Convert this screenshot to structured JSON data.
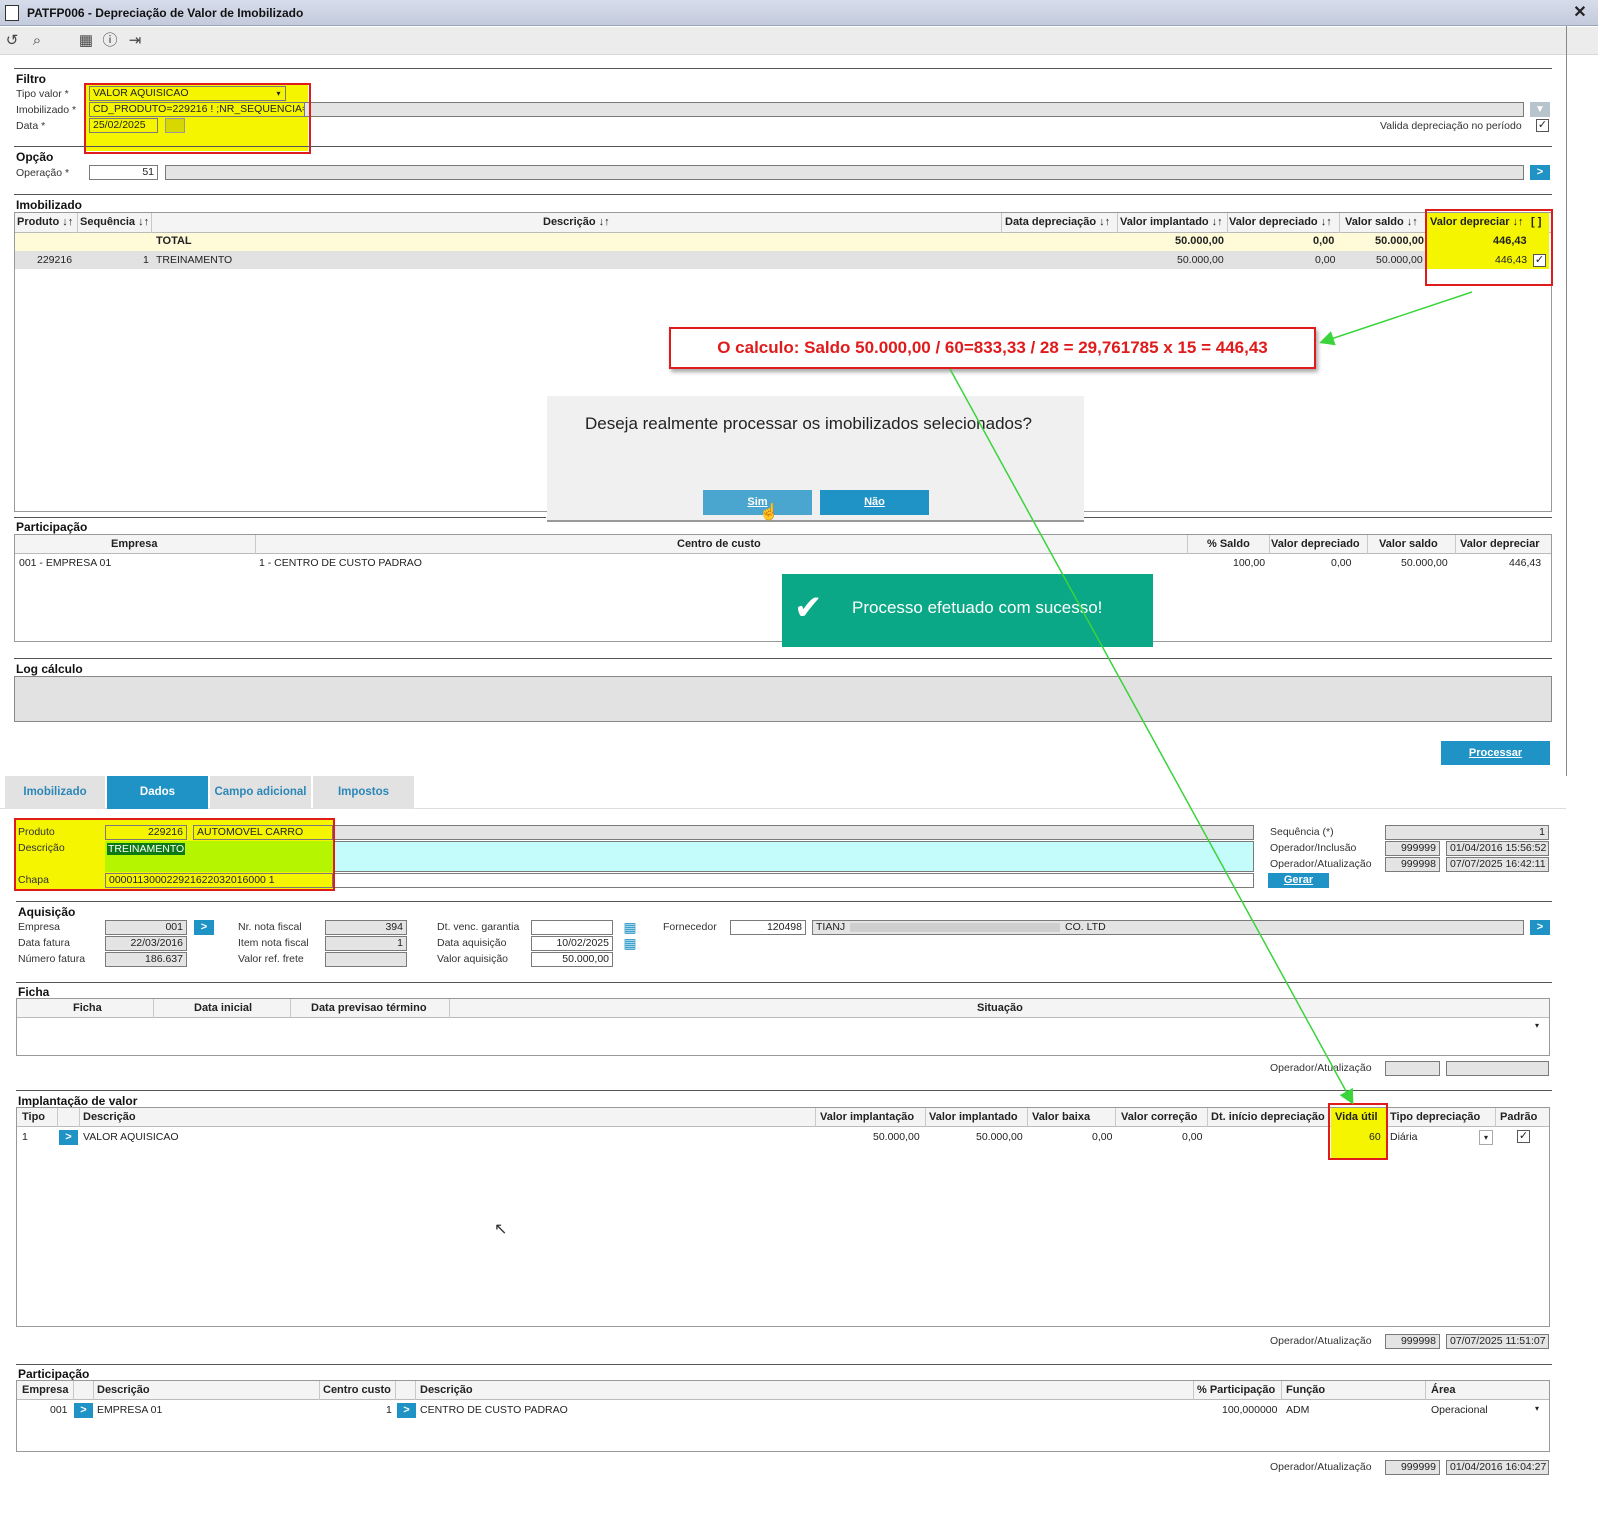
{
  "window": {
    "title": "PATFP006 - Depreciação de Valor de Imobilizado",
    "close": "✕"
  },
  "filtro": {
    "title": "Filtro",
    "tipo_valor_label": "Tipo valor *",
    "tipo_valor": "VALOR AQUISICAO",
    "imobilizado_label": "Imobilizado *",
    "imobilizado": "CD_PRODUTO=229216 ! ;NR_SEQUENCIA=1",
    "data_label": "Data *",
    "data": "25/02/2025",
    "valida_label": "Valida depreciação no período"
  },
  "opcao": {
    "title": "Opção",
    "operacao_label": "Operação *",
    "operacao": "51"
  },
  "imobilizado": {
    "title": "Imobilizado",
    "headers": [
      "Produto ↓↑",
      "Sequência ↓↑",
      "Descrição ↓↑",
      "Data depreciação ↓↑",
      "Valor implantado ↓↑",
      "Valor depreciado ↓↑",
      "Valor saldo ↓↑",
      "Valor depreciar ↓↑",
      "[ ]"
    ],
    "total": {
      "label": "TOTAL",
      "valor_implantado": "50.000,00",
      "valor_depreciado": "0,00",
      "valor_saldo": "50.000,00",
      "valor_depreciar": "446,43"
    },
    "row": {
      "produto": "229216",
      "sequencia": "1",
      "descricao": "TREINAMENTO",
      "valor_implantado": "50.000,00",
      "valor_depreciado": "0,00",
      "valor_saldo": "50.000,00",
      "valor_depreciar": "446,43"
    }
  },
  "annotation": {
    "text": "O calculo: Saldo 50.000,00 / 60=833,33  / 28 =  29,761785 x 15 = 446,43"
  },
  "dialog": {
    "message": "Deseja realmente processar os imobilizados selecionados?",
    "yes": "Sim",
    "no": "Não"
  },
  "toast": {
    "message": "Processo efetuado com sucesso!"
  },
  "participacao_top": {
    "title": "Participação",
    "headers": [
      "Empresa",
      "Centro de custo",
      "% Saldo",
      "Valor depreciado",
      "Valor saldo",
      "Valor depreciar"
    ],
    "row": [
      "001 - EMPRESA 01",
      "1 - CENTRO DE CUSTO PADRAO",
      "100,00",
      "0,00",
      "50.000,00",
      "446,43"
    ]
  },
  "log": {
    "title": "Log cálculo"
  },
  "processar": "Processar",
  "tabs": [
    "Imobilizado",
    "Dados",
    "Campo adicional",
    "Impostos"
  ],
  "dados": {
    "produto_label": "Produto",
    "produto": "229216",
    "produto_nome": "AUTOMOVEL CARRO",
    "descricao_label": "Descrição",
    "descricao": "TREINAMENTO",
    "chapa_label": "Chapa",
    "chapa": "000011300022921622032016000 1",
    "sequencia_label": "Sequência (*)",
    "sequencia": "1",
    "op_inclusao_label": "Operador/Inclusão",
    "op_inclusao": "999999",
    "op_inclusao_data": "01/04/2016 15:56:52",
    "op_atualizacao_label": "Operador/Atualização",
    "op_atualizacao": "999998",
    "op_atualizacao_data": "07/07/2025 16:42:11",
    "gerar": "Gerar"
  },
  "aquisicao": {
    "title": "Aquisição",
    "empresa_label": "Empresa",
    "empresa": "001",
    "data_fatura_label": "Data fatura",
    "data_fatura": "22/03/2016",
    "numero_fatura_label": "Número fatura",
    "numero_fatura": "186.637",
    "nr_nota_label": "Nr. nota fiscal",
    "nr_nota": "394",
    "item_nota_label": "Item nota fiscal",
    "item_nota": "1",
    "frete_label": "Valor ref. frete",
    "frete": "",
    "dt_garantia_label": "Dt. venc. garantia",
    "dt_garantia": "",
    "data_aquisicao_label": "Data aquisição",
    "data_aquisicao": "10/02/2025",
    "valor_aquisicao_label": "Valor aquisição",
    "valor_aquisicao": "50.000,00",
    "fornecedor_label": "Fornecedor",
    "fornecedor": "120498",
    "fornecedor_nome": "TIANJ",
    "fornecedor_nome_end": "CO. LTD"
  },
  "ficha": {
    "title": "Ficha",
    "headers": [
      "Ficha",
      "Data inicial",
      "Data previsao término",
      "Situação"
    ],
    "op_label": "Operador/Atualização"
  },
  "implantacao": {
    "title": "Implantação de valor",
    "headers": [
      "Tipo",
      "Descrição",
      "Valor implantação",
      "Valor implantado",
      "Valor baixa",
      "Valor correção",
      "Dt. início depreciação",
      "Vida útil",
      "Tipo depreciação",
      "Padrão"
    ],
    "row": {
      "tipo": "1",
      "descricao": "VALOR AQUISICAO",
      "valor_implantacao": "50.000,00",
      "valor_implantado": "50.000,00",
      "valor_baixa": "0,00",
      "valor_correcao": "0,00",
      "vida_util": "60",
      "tipo_depreciacao": "Diária"
    },
    "op_label": "Operador/Atualização",
    "op": "999998",
    "op_data": "07/07/2025 11:51:07"
  },
  "participacao_bottom": {
    "title": "Participação",
    "headers": [
      "Empresa",
      "Descrição",
      "Centro custo",
      "Descrição",
      "% Participação",
      "Função",
      "Área"
    ],
    "row": {
      "empresa": "001",
      "descricao": "EMPRESA 01",
      "centro": "1",
      "centro_desc": "CENTRO DE CUSTO PADRAO",
      "perc": "100,000000",
      "funcao": "ADM",
      "area": "Operacional"
    },
    "op_label": "Operador/Atualização",
    "op": "999999",
    "op_data": "01/04/2016 16:04:27"
  },
  "colors": {
    "accent": "#1f92c6",
    "highlight": "#f5f500",
    "annotation_red": "#e01b1b",
    "toast_green": "#0aa886",
    "arrow_green": "#3bd43b"
  }
}
